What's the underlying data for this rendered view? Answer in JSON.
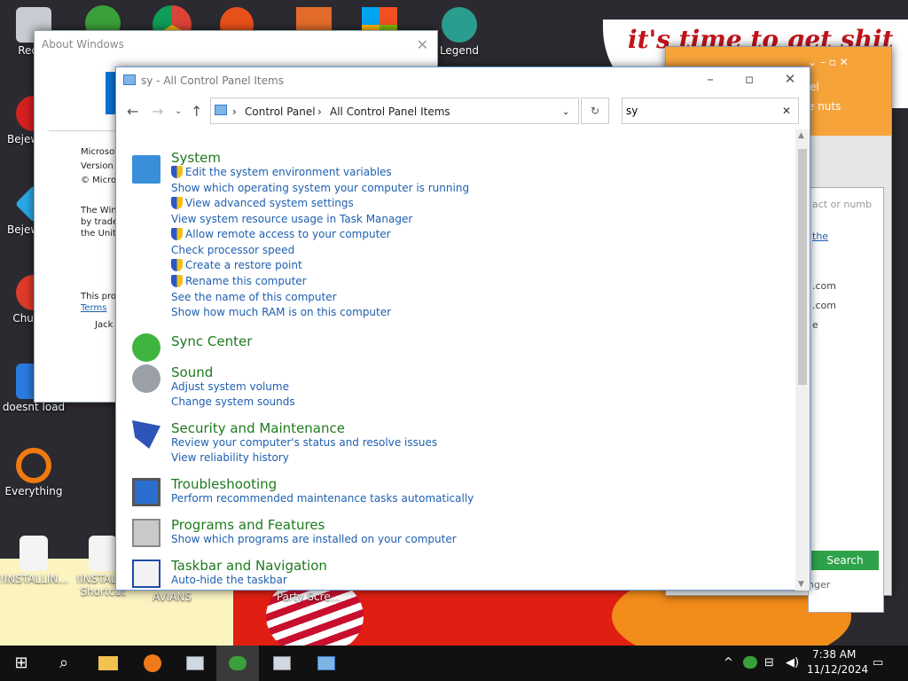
{
  "desktop": {
    "wallpaper_text": "it's time to get shit",
    "icons": [
      {
        "label": "Recyc",
        "name": "recycle-bin"
      },
      {
        "label": "Bejew Del",
        "name": "bejeweled-deluxe-shortcut"
      },
      {
        "label": "Bejew Del",
        "name": "bejeweled-2-shortcut"
      },
      {
        "label": "Chu Del",
        "name": "chuzzle-deluxe-shortcut"
      },
      {
        "label": "doesnt load",
        "name": "doesnt-load-shortcut"
      },
      {
        "label": "Everything",
        "name": "everything-app"
      },
      {
        "label": "!INSTALLIN...",
        "name": "installing-file"
      },
      {
        "label": "!INSTALL - Shortcut",
        "name": "installing-shortcut"
      },
      {
        "label": "AVIANS",
        "name": "avians-shortcut"
      },
      {
        "label": "Party Scre...",
        "name": "party-screen-shortcut"
      },
      {
        "label": "Legend",
        "name": "legend-shortcut"
      }
    ]
  },
  "about_window": {
    "title": "About Windows",
    "lines": [
      "Microsof",
      "Version",
      "© Micro",
      "The Win",
      "by trade",
      "the Unit",
      "This pro",
      "Terms",
      "Jack"
    ]
  },
  "search_app": {
    "menu1": "el",
    "menu2": "e nuts",
    "placeholder": "act or numb",
    "link": "the",
    "results": [
      ".com",
      ".com",
      "e"
    ],
    "footer": "nger",
    "search_btn": "Search"
  },
  "control_panel": {
    "title": "sy - All Control Panel Items",
    "breadcrumb": [
      "Control Panel",
      "All Control Panel Items"
    ],
    "search_value": "sy",
    "groups": [
      {
        "title": "System",
        "icon": "system-icon",
        "tasks": [
          {
            "label": "Edit the system environment variables",
            "shield": true
          },
          {
            "label": "Show which operating system your computer is running",
            "shield": false
          },
          {
            "label": "View advanced system settings",
            "shield": true
          },
          {
            "label": "View system resource usage in Task Manager",
            "shield": false
          },
          {
            "label": "Allow remote access to your computer",
            "shield": true
          },
          {
            "label": "Check processor speed",
            "shield": false
          },
          {
            "label": "Create a restore point",
            "shield": true
          },
          {
            "label": "Rename this computer",
            "shield": true
          },
          {
            "label": "See the name of this computer",
            "shield": false
          },
          {
            "label": "Show how much RAM is on this computer",
            "shield": false
          }
        ]
      },
      {
        "title": "Sync Center",
        "icon": "sync-center-icon",
        "tasks": []
      },
      {
        "title": "Sound",
        "icon": "sound-icon",
        "tasks": [
          {
            "label": "Adjust system volume",
            "shield": false
          },
          {
            "label": "Change system sounds",
            "shield": false
          }
        ]
      },
      {
        "title": "Security and Maintenance",
        "icon": "security-maintenance-icon",
        "tasks": [
          {
            "label": "Review your computer's status and resolve issues",
            "shield": false
          },
          {
            "label": "View reliability history",
            "shield": false
          }
        ]
      },
      {
        "title": "Troubleshooting",
        "icon": "troubleshooting-icon",
        "tasks": [
          {
            "label": "Perform recommended maintenance tasks automatically",
            "shield": false
          }
        ]
      },
      {
        "title": "Programs and Features",
        "icon": "programs-features-icon",
        "tasks": [
          {
            "label": "Show which programs are installed on your computer",
            "shield": false
          }
        ]
      },
      {
        "title": "Taskbar and Navigation",
        "icon": "taskbar-navigation-icon",
        "tasks": [
          {
            "label": "Auto-hide the taskbar",
            "shield": false
          }
        ]
      }
    ]
  },
  "taskbar": {
    "time": "7:38 AM",
    "date": "11/12/2024"
  }
}
